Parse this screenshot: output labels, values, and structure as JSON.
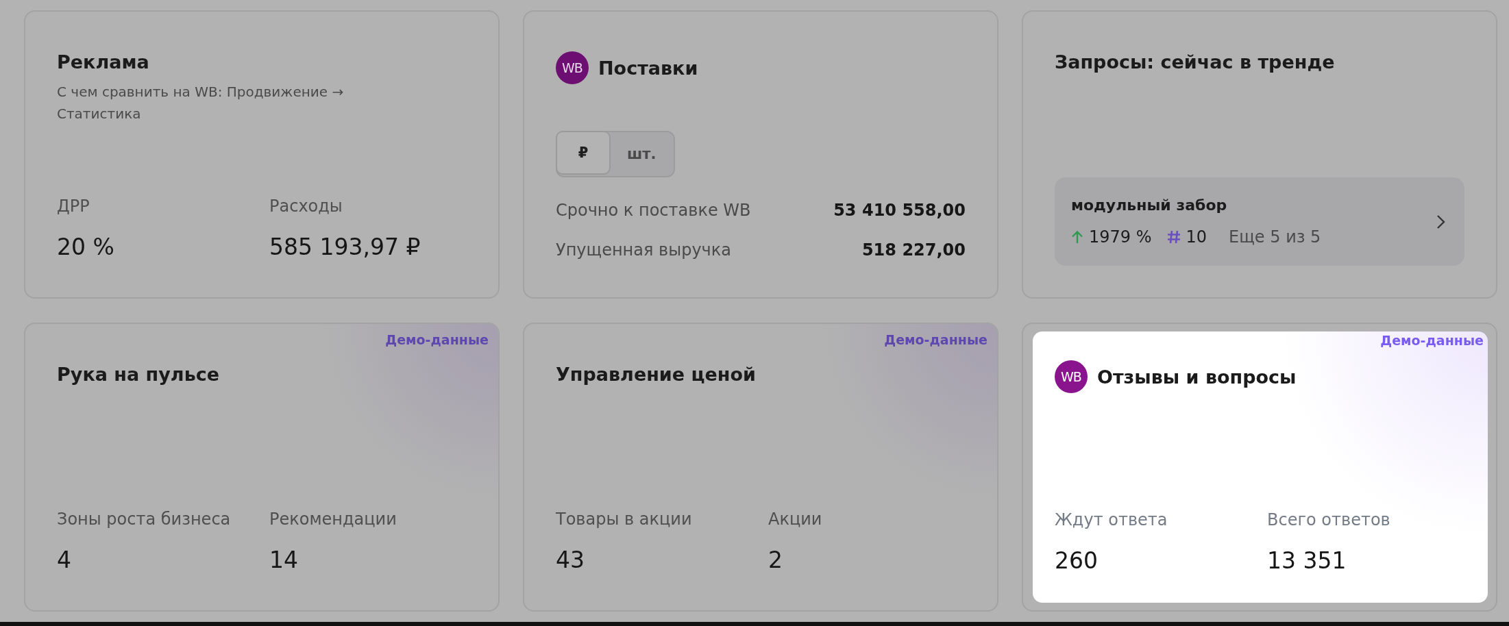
{
  "cards": [
    {
      "kind": "stats",
      "title": "Реклама",
      "subtitle": "С чем сравнить на WB: Продвижение → Статистика",
      "highlighted": false,
      "stats": [
        {
          "label": "ДРР",
          "value": "20 %"
        },
        {
          "label": "Расходы",
          "value": "585 193,97 ₽"
        }
      ]
    },
    {
      "kind": "supplies",
      "title": "Поставки",
      "badge": "WB",
      "highlighted": false,
      "toggle": [
        {
          "label": "₽",
          "selected": true
        },
        {
          "label": "шт.",
          "selected": false
        }
      ],
      "rows": [
        {
          "label": "Срочно к поставке WB",
          "value": "53 410 558,00"
        },
        {
          "label": "Упущенная выручка",
          "value": "518 227,00"
        }
      ]
    },
    {
      "kind": "trends",
      "title": "Запросы: сейчас в тренде",
      "highlighted": false,
      "query": {
        "text": "модульный забор",
        "growth": "1979 %",
        "rank": "10",
        "more": "Еще 5 из 5"
      }
    },
    {
      "kind": "stats",
      "title": "Рука на пульсе",
      "demo": "Демо-данные",
      "highlighted": false,
      "stats": [
        {
          "label": "Зоны роста бизнеса",
          "value": "4"
        },
        {
          "label": "Рекомендации",
          "value": "14"
        }
      ]
    },
    {
      "kind": "stats",
      "title": "Управление ценой",
      "demo": "Демо-данные",
      "highlighted": false,
      "stats": [
        {
          "label": "Товары в акции",
          "value": "43"
        },
        {
          "label": "Акции",
          "value": "2"
        }
      ]
    },
    {
      "kind": "stats",
      "title": "Отзывы и вопросы",
      "badge": "WB",
      "demo": "Демо-данные",
      "highlighted": true,
      "stats": [
        {
          "label": "Ждут ответа",
          "value": "260"
        },
        {
          "label": "Всего ответов",
          "value": "13 351"
        }
      ]
    }
  ]
}
